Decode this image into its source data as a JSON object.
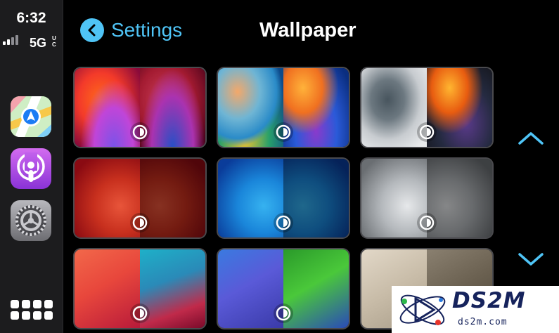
{
  "status_bar": {
    "time": "6:32",
    "network": "5G",
    "network_sup_top": "U",
    "network_sup_bottom": "C",
    "signal_bars": 2
  },
  "sidebar": {
    "apps": [
      {
        "name": "Maps",
        "icon": "maps-icon"
      },
      {
        "name": "Podcasts",
        "icon": "podcasts-icon"
      },
      {
        "name": "Settings",
        "icon": "settings-gear-icon"
      }
    ],
    "home_icon": "app-grid-icon"
  },
  "header": {
    "back_label": "Settings",
    "title": "Wallpaper"
  },
  "colors": {
    "accent": "#4fc4f6",
    "background": "#000000",
    "sidebar": "#1c1c1e"
  },
  "wallpapers": [
    {
      "name": "red-orange",
      "icon": "appearance-toggle-icon"
    },
    {
      "name": "blue-yellow",
      "icon": "appearance-toggle-icon"
    },
    {
      "name": "gray-orange",
      "icon": "appearance-toggle-icon"
    },
    {
      "name": "red",
      "icon": "appearance-toggle-icon"
    },
    {
      "name": "blue",
      "icon": "appearance-toggle-icon"
    },
    {
      "name": "gray",
      "icon": "appearance-toggle-icon"
    },
    {
      "name": "coral-teal",
      "icon": "appearance-toggle-icon"
    },
    {
      "name": "blue-green",
      "icon": "appearance-toggle-icon"
    },
    {
      "name": "beige",
      "icon": "appearance-toggle-icon"
    }
  ],
  "navigation": {
    "scroll_up_icon": "chevron-up-icon",
    "scroll_down_icon": "chevron-down-icon"
  },
  "watermark": {
    "brand": "DS2M",
    "domain": "ds2m.com"
  }
}
